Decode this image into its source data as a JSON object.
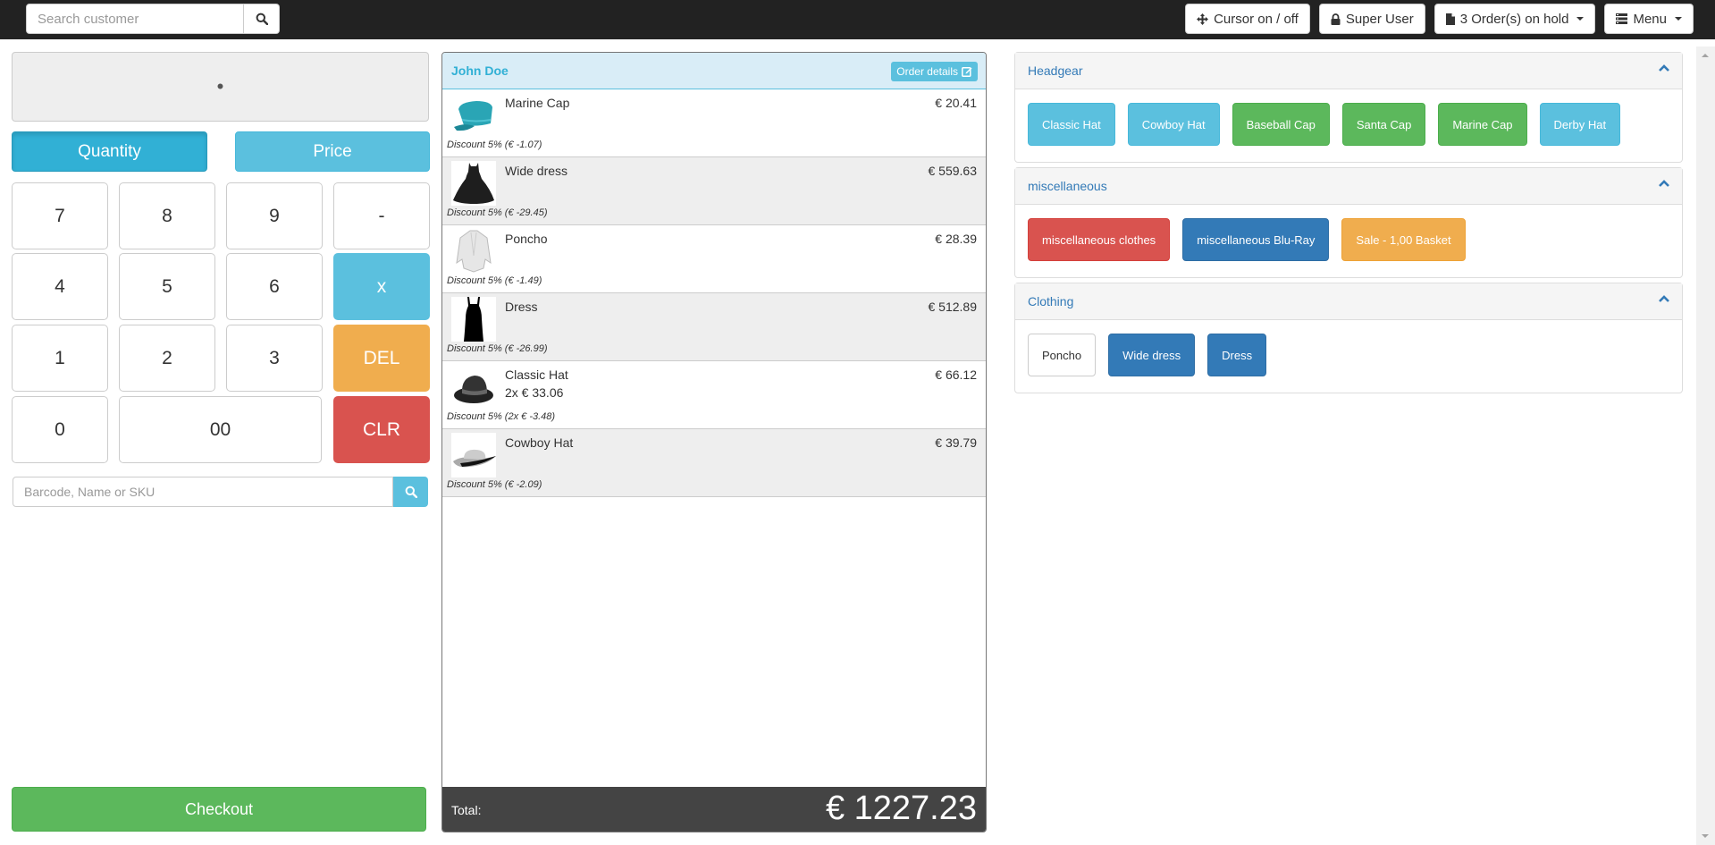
{
  "navbar": {
    "search_placeholder": "Search customer",
    "buttons": {
      "cursor": "Cursor on / off",
      "user": "Super User",
      "hold": "3 Order(s) on hold",
      "menu": "Menu"
    }
  },
  "numpad": {
    "display": "•",
    "modes": {
      "quantity": "Quantity",
      "price": "Price"
    },
    "keys": {
      "k7": "7",
      "k8": "8",
      "k9": "9",
      "minus": "-",
      "k4": "4",
      "k5": "5",
      "k6": "6",
      "times": "x",
      "k1": "1",
      "k2": "2",
      "k3": "3",
      "del": "DEL",
      "k0": "0",
      "k00": "00",
      "clr": "CLR"
    },
    "barcode_placeholder": "Barcode, Name or SKU",
    "checkout": "Checkout"
  },
  "order": {
    "customer": "John Doe",
    "details_label": "Order details",
    "lines": [
      {
        "name": "Marine Cap",
        "price": "€ 20.41",
        "sub": "",
        "discount": "Discount 5% (€ -1.07)",
        "icon": "marine-cap"
      },
      {
        "name": "Wide dress",
        "price": "€ 559.63",
        "sub": "",
        "discount": "Discount 5% (€ -29.45)",
        "icon": "wide-dress"
      },
      {
        "name": "Poncho",
        "price": "€ 28.39",
        "sub": "",
        "discount": "Discount 5% (€ -1.49)",
        "icon": "poncho"
      },
      {
        "name": "Dress",
        "price": "€ 512.89",
        "sub": "",
        "discount": "Discount 5% (€ -26.99)",
        "icon": "dress"
      },
      {
        "name": "Classic Hat",
        "price": "€ 66.12",
        "sub": "2x € 33.06",
        "discount": "Discount 5% (2x € -3.48)",
        "icon": "classic-hat"
      },
      {
        "name": "Cowboy Hat",
        "price": "€ 39.79",
        "sub": "",
        "discount": "Discount 5% (€ -2.09)",
        "icon": "cowboy-hat"
      }
    ],
    "total_label": "Total:",
    "total_value": "€ 1227.23"
  },
  "categories": [
    {
      "title": "Headgear",
      "products": [
        {
          "label": "Classic Hat",
          "style": "info"
        },
        {
          "label": "Cowboy Hat",
          "style": "info"
        },
        {
          "label": "Baseball Cap",
          "style": "success"
        },
        {
          "label": "Santa Cap",
          "style": "success"
        },
        {
          "label": "Marine Cap",
          "style": "success"
        },
        {
          "label": "Derby Hat",
          "style": "info"
        }
      ]
    },
    {
      "title": "miscellaneous",
      "products": [
        {
          "label": "miscellaneous clothes",
          "style": "danger"
        },
        {
          "label": "miscellaneous Blu-Ray",
          "style": "primary"
        },
        {
          "label": "Sale - 1,00 Basket",
          "style": "warning"
        }
      ]
    },
    {
      "title": "Clothing",
      "products": [
        {
          "label": "Poncho",
          "style": "default"
        },
        {
          "label": "Wide dress",
          "style": "primary"
        },
        {
          "label": "Dress",
          "style": "primary"
        }
      ]
    }
  ],
  "colors": {
    "navbar": "#222222",
    "info": "#5bc0de",
    "success": "#5cb85c",
    "danger": "#d9534f",
    "primary": "#337ab7",
    "warning": "#f0ad4e",
    "total_bar": "#444444"
  }
}
